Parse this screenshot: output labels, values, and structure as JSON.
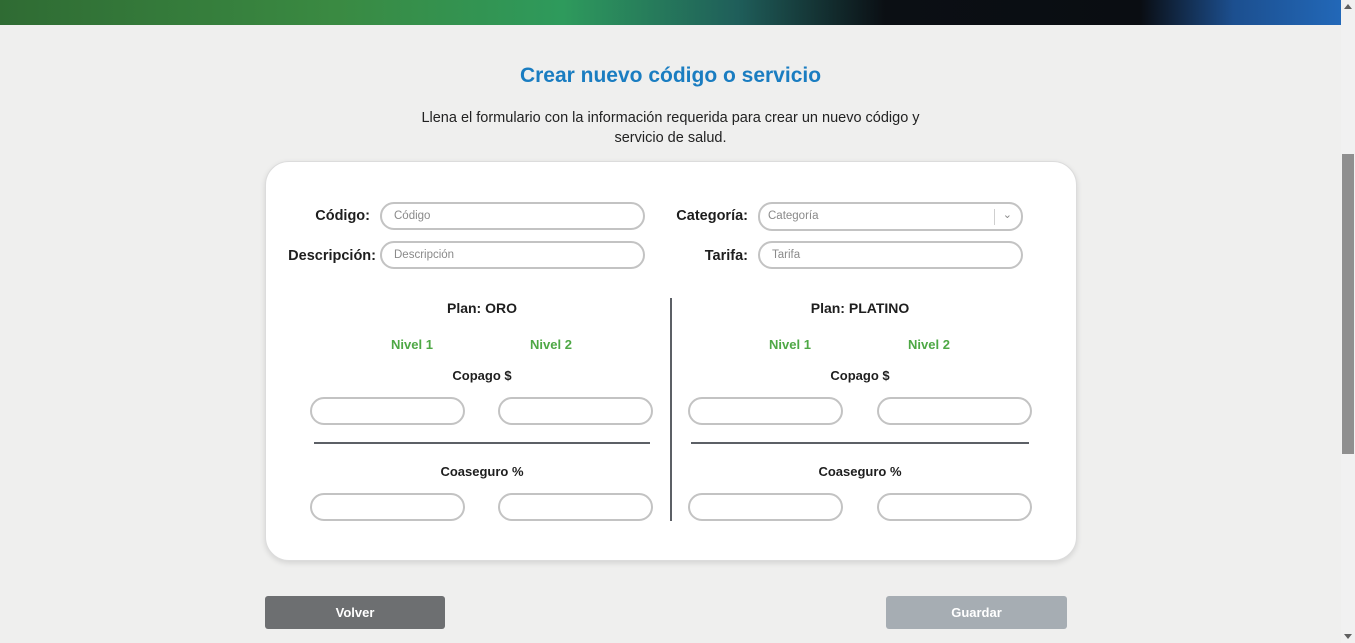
{
  "page": {
    "title": "Crear nuevo código o servicio",
    "subtitle": "Llena el formulario con la información requerida para crear un nuevo código y servicio de salud."
  },
  "form": {
    "codigo": {
      "label": "Código:",
      "placeholder": "Código"
    },
    "descripcion": {
      "label": "Descripción:",
      "placeholder": "Descripción"
    },
    "categoria": {
      "label": "Categoría:",
      "placeholder": "Categoría"
    },
    "tarifa": {
      "label": "Tarifa:",
      "placeholder": "Tarifa"
    }
  },
  "plans": [
    {
      "title": "Plan: ORO",
      "nivel1": "Nivel 1",
      "nivel2": "Nivel 2",
      "copago_label": "Copago $",
      "coaseguro_label": "Coaseguro %"
    },
    {
      "title": "Plan: PLATINO",
      "nivel1": "Nivel 1",
      "nivel2": "Nivel 2",
      "copago_label": "Copago $",
      "coaseguro_label": "Coaseguro %"
    }
  ],
  "buttons": {
    "back": "Volver",
    "save": "Guardar"
  },
  "colors": {
    "title": "#1a7dc1",
    "nivel": "#4ea845",
    "back_button": "#6d6f71",
    "save_button_disabled": "#a6adb3"
  },
  "icons": {
    "categoria_select": "chevron-down-icon"
  }
}
